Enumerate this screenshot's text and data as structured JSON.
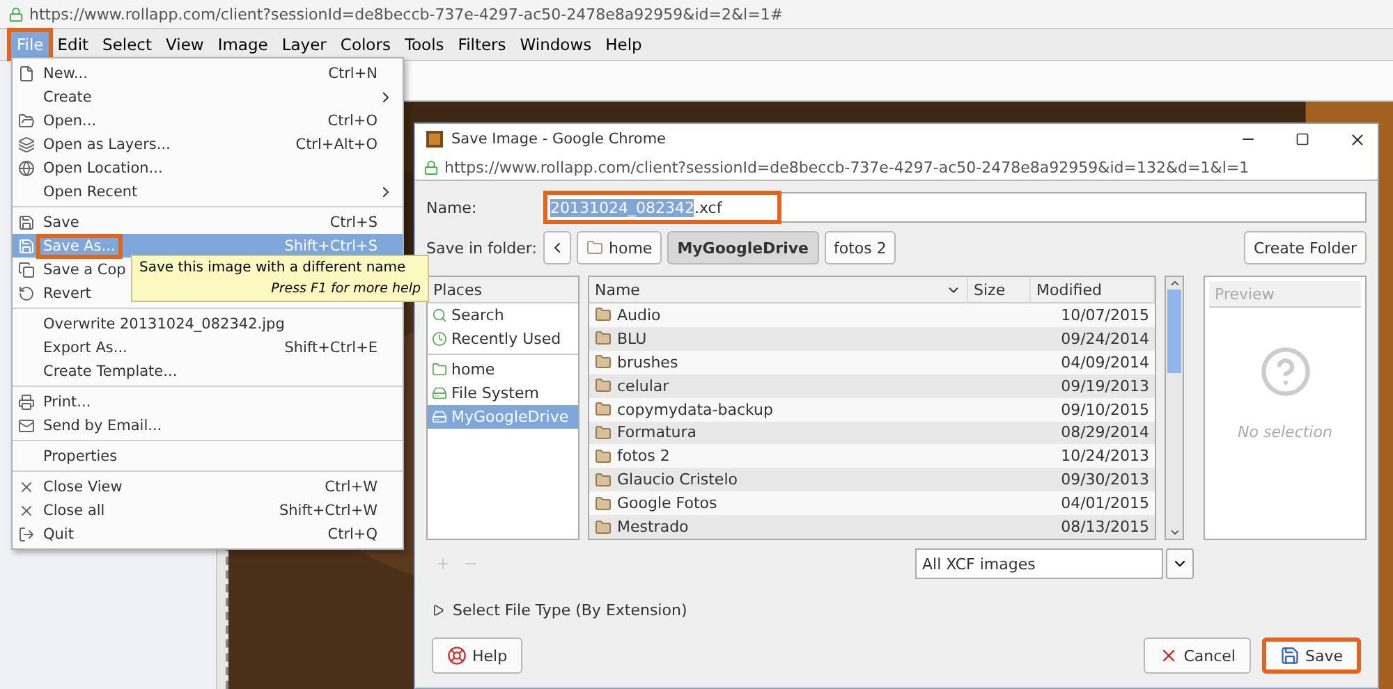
{
  "browser": {
    "url": "https://www.rollapp.com/client?sessionId=de8beccb-737e-4297-ac50-2478e8a92959&id=2&l=1#"
  },
  "menubar": [
    {
      "label": "File",
      "selected": true,
      "annotated": true
    },
    {
      "label": "Edit",
      "selected": false,
      "annotated": false
    },
    {
      "label": "Select",
      "selected": false,
      "annotated": false
    },
    {
      "label": "View",
      "selected": false,
      "annotated": false
    },
    {
      "label": "Image",
      "selected": false,
      "annotated": false
    },
    {
      "label": "Layer",
      "selected": false,
      "annotated": false
    },
    {
      "label": "Colors",
      "selected": false,
      "annotated": false
    },
    {
      "label": "Tools",
      "selected": false,
      "annotated": false
    },
    {
      "label": "Filters",
      "selected": false,
      "annotated": false
    },
    {
      "label": "Windows",
      "selected": false,
      "annotated": false
    },
    {
      "label": "Help",
      "selected": false,
      "annotated": false
    }
  ],
  "file_menu": [
    {
      "kind": "item",
      "label": "New...",
      "shortcut": "Ctrl+N",
      "submenu": false,
      "selected": false,
      "annotated": false
    },
    {
      "kind": "item",
      "label": "Create",
      "submenu": true,
      "selected": false,
      "annotated": false
    },
    {
      "kind": "item",
      "label": "Open...",
      "shortcut": "Ctrl+O",
      "submenu": false,
      "selected": false,
      "annotated": false
    },
    {
      "kind": "item",
      "label": "Open as Layers...",
      "shortcut": "Ctrl+Alt+O",
      "submenu": false,
      "selected": false,
      "annotated": false
    },
    {
      "kind": "item",
      "label": "Open Location...",
      "submenu": false,
      "selected": false,
      "annotated": false
    },
    {
      "kind": "item",
      "label": "Open Recent",
      "submenu": true,
      "selected": false,
      "annotated": false
    },
    {
      "kind": "separator"
    },
    {
      "kind": "item",
      "label": "Save",
      "shortcut": "Ctrl+S",
      "submenu": false,
      "selected": false,
      "annotated": false
    },
    {
      "kind": "item",
      "label": "Save As...",
      "shortcut": "Shift+Ctrl+S",
      "submenu": false,
      "selected": true,
      "annotated": true
    },
    {
      "kind": "item",
      "label": "Save a Cop",
      "submenu": false,
      "selected": false,
      "annotated": false
    },
    {
      "kind": "item",
      "label": "Revert",
      "submenu": false,
      "selected": false,
      "annotated": false
    },
    {
      "kind": "separator"
    },
    {
      "kind": "item",
      "label": "Overwrite 20131024_082342.jpg",
      "submenu": false,
      "selected": false,
      "annotated": false
    },
    {
      "kind": "item",
      "label": "Export As...",
      "shortcut": "Shift+Ctrl+E",
      "submenu": false,
      "selected": false,
      "annotated": false
    },
    {
      "kind": "item",
      "label": "Create Template...",
      "submenu": false,
      "selected": false,
      "annotated": false
    },
    {
      "kind": "separator"
    },
    {
      "kind": "item",
      "label": "Print...",
      "submenu": false,
      "selected": false,
      "annotated": false
    },
    {
      "kind": "item",
      "label": "Send by Email...",
      "submenu": false,
      "selected": false,
      "annotated": false
    },
    {
      "kind": "separator"
    },
    {
      "kind": "item",
      "label": "Properties",
      "submenu": false,
      "selected": false,
      "annotated": false
    },
    {
      "kind": "separator"
    },
    {
      "kind": "item",
      "label": "Close View",
      "shortcut": "Ctrl+W",
      "submenu": false,
      "selected": false,
      "annotated": false
    },
    {
      "kind": "item",
      "label": "Close all",
      "shortcut": "Shift+Ctrl+W",
      "submenu": false,
      "selected": false,
      "annotated": false
    },
    {
      "kind": "item",
      "label": "Quit",
      "shortcut": "Ctrl+Q",
      "submenu": false,
      "selected": false,
      "annotated": false
    }
  ],
  "tooltip": {
    "text": "Save this image with a different name",
    "hint": "Press F1 for more help"
  },
  "dialog": {
    "title": "Save Image - Google Chrome",
    "url": "https://www.rollapp.com/client?sessionId=de8beccb-737e-4297-ac50-2478e8a92959&id=132&d=1&l=1",
    "name_label": "Name:",
    "name_selected": "20131024_082342",
    "name_rest": ".xcf",
    "name_annotated": true,
    "folder_label": "Save in folder:",
    "crumbs": [
      {
        "label": "home",
        "selected": false
      },
      {
        "label": "MyGoogleDrive",
        "selected": true
      },
      {
        "label": "fotos 2",
        "selected": false
      }
    ],
    "create_folder": "Create Folder",
    "places_header": "Places",
    "places": [
      {
        "kind": "item",
        "label": "Search",
        "selected": false
      },
      {
        "kind": "item",
        "label": "Recently Used",
        "selected": false
      },
      {
        "kind": "separator"
      },
      {
        "kind": "item",
        "label": "home",
        "selected": false
      },
      {
        "kind": "item",
        "label": "File System",
        "selected": false
      },
      {
        "kind": "item",
        "label": "MyGoogleDrive",
        "selected": true
      }
    ],
    "columns": [
      "Name",
      "Size",
      "Modified"
    ],
    "rows": [
      {
        "name": "Audio",
        "modified": "10/07/2015"
      },
      {
        "name": "BLU",
        "modified": "09/24/2014"
      },
      {
        "name": "brushes",
        "modified": "04/09/2014"
      },
      {
        "name": "celular",
        "modified": "09/19/2013"
      },
      {
        "name": "copymydata-backup",
        "modified": "09/10/2015"
      },
      {
        "name": "Formatura",
        "modified": "08/29/2014"
      },
      {
        "name": "fotos 2",
        "modified": "10/24/2013"
      },
      {
        "name": "Glaucio Cristelo",
        "modified": "09/30/2013"
      },
      {
        "name": "Google Fotos",
        "modified": "04/01/2015"
      },
      {
        "name": "Mestrado",
        "modified": "08/13/2015"
      }
    ],
    "preview_header": "Preview",
    "preview_text": "No selection",
    "filter": "All XCF images",
    "expander": {
      "label": "Select File Type (By Extension)",
      "expanded": false
    },
    "buttons": [
      {
        "kind": "help",
        "label": "Help",
        "annotated": false
      },
      {
        "kind": "cancel",
        "label": "Cancel",
        "annotated": false
      },
      {
        "kind": "save",
        "label": "Save",
        "annotated": true
      }
    ]
  }
}
